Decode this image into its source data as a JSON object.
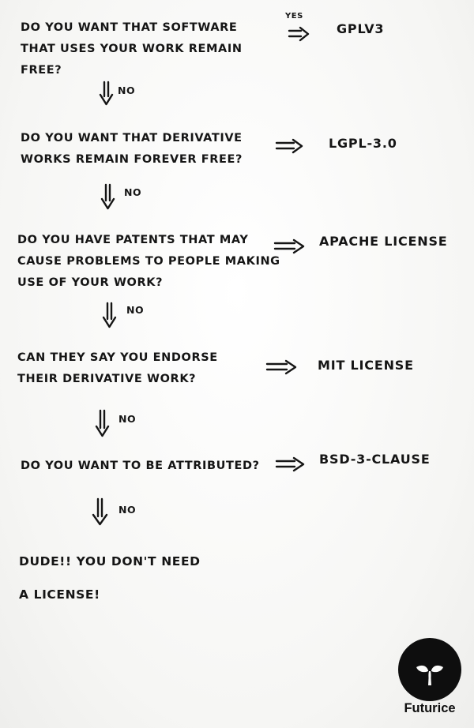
{
  "steps": [
    {
      "question_lines": [
        "Do you want that software",
        "that uses your work remain",
        "free?"
      ],
      "answer": "GPLv3",
      "branch_label": "No"
    },
    {
      "question_lines": [
        "Do you want that derivative",
        "works remain forever free?"
      ],
      "answer": "LGPL-3.0",
      "branch_label": "No"
    },
    {
      "question_lines": [
        "Do you have patents that may",
        "cause problems to people making",
        "use of your work?"
      ],
      "answer": "Apache license",
      "branch_label": "No"
    },
    {
      "question_lines": [
        "Can they say you endorse",
        "their derivative work?"
      ],
      "answer": "MIT license",
      "branch_label": "No"
    },
    {
      "question_lines": [
        "Do you want to be attributed?"
      ],
      "answer": "BSD-3-clause",
      "branch_label": "No"
    }
  ],
  "first_answer_label": "Yes",
  "conclusion_lines": [
    "Dude!! You don't need",
    "a license!"
  ],
  "logo": {
    "brand": "Futurice",
    "color": "#0e0e0e"
  }
}
